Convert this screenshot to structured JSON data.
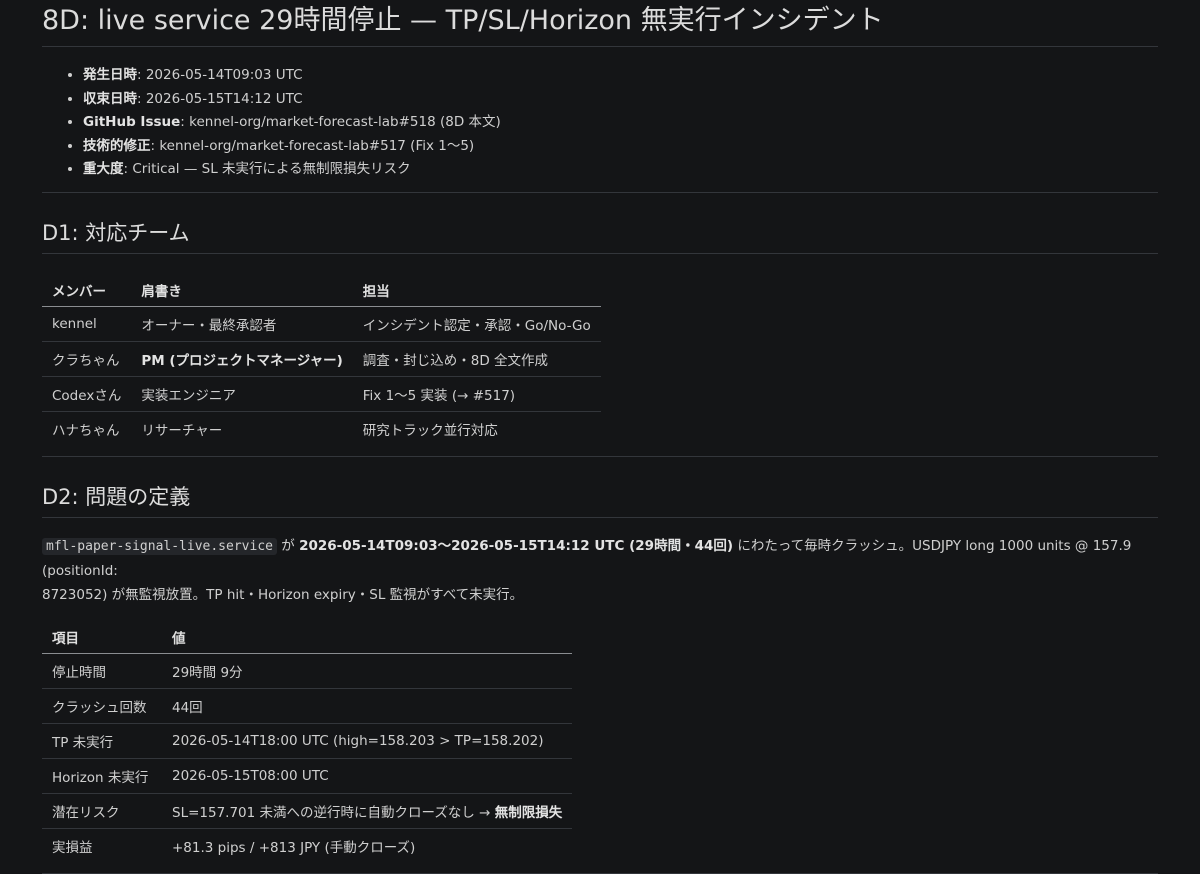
{
  "title": "8D: live service 29時間停止 — TP/SL/Horizon 無実行インシデント",
  "meta": [
    {
      "key": "発生日時",
      "value": ": 2026-05-14T09:03 UTC"
    },
    {
      "key": "収束日時",
      "value": ": 2026-05-15T14:12 UTC"
    },
    {
      "key": "GitHub Issue",
      "value": ": kennel-org/market-forecast-lab#518 (8D 本文)"
    },
    {
      "key": "技術的修正",
      "value": ": kennel-org/market-forecast-lab#517 (Fix 1〜5)"
    },
    {
      "key": "重大度",
      "value": ": Critical — SL 未実行による無制限損失リスク"
    }
  ],
  "d1": {
    "heading": "D1: 対応チーム",
    "headers": [
      "メンバー",
      "肩書き",
      "担当"
    ],
    "rows": [
      [
        "kennel",
        "オーナー・最終承認者",
        "インシデント認定・承認・Go/No-Go"
      ],
      [
        "クラちゃん",
        "PM (プロジェクトマネージャー)",
        "調査・封じ込め・8D 全文作成"
      ],
      [
        "Codexさん",
        "実装エンジニア",
        "Fix 1〜5 実装 (→ #517)"
      ],
      [
        "ハナちゃん",
        "リサーチャー",
        "研究トラック並行対応"
      ]
    ]
  },
  "d2": {
    "heading": "D2: 問題の定義",
    "service_code": "mfl-paper-signal-live.service",
    "text_ga": " が ",
    "text_period": "2026-05-14T09:03〜2026-05-15T14:12 UTC (29時間・44回)",
    "text_line1_rest": " にわたって毎時クラッシュ。USDJPY long 1000 units @ 157.9 (positionId:",
    "text_line2": "8723052) が無監視放置。TP hit・Horizon expiry・SL 監視がすべて未実行。",
    "headers": [
      "項目",
      "値"
    ],
    "rows": [
      [
        "停止時間",
        "29時間 9分"
      ],
      [
        "クラッシュ回数",
        "44回"
      ],
      [
        "TP 未実行",
        "2026-05-14T18:00 UTC (high=158.203 > TP=158.202)"
      ],
      [
        "Horizon 未実行",
        "2026-05-15T08:00 UTC"
      ],
      [
        "潜在リスク",
        "SL=157.701 未満への逆行時に自動クローズなし → "
      ],
      [
        "実損益",
        "+81.3 pips / +813 JPY (手動クローズ)"
      ]
    ],
    "risk_emphasis": "無制限損失"
  }
}
